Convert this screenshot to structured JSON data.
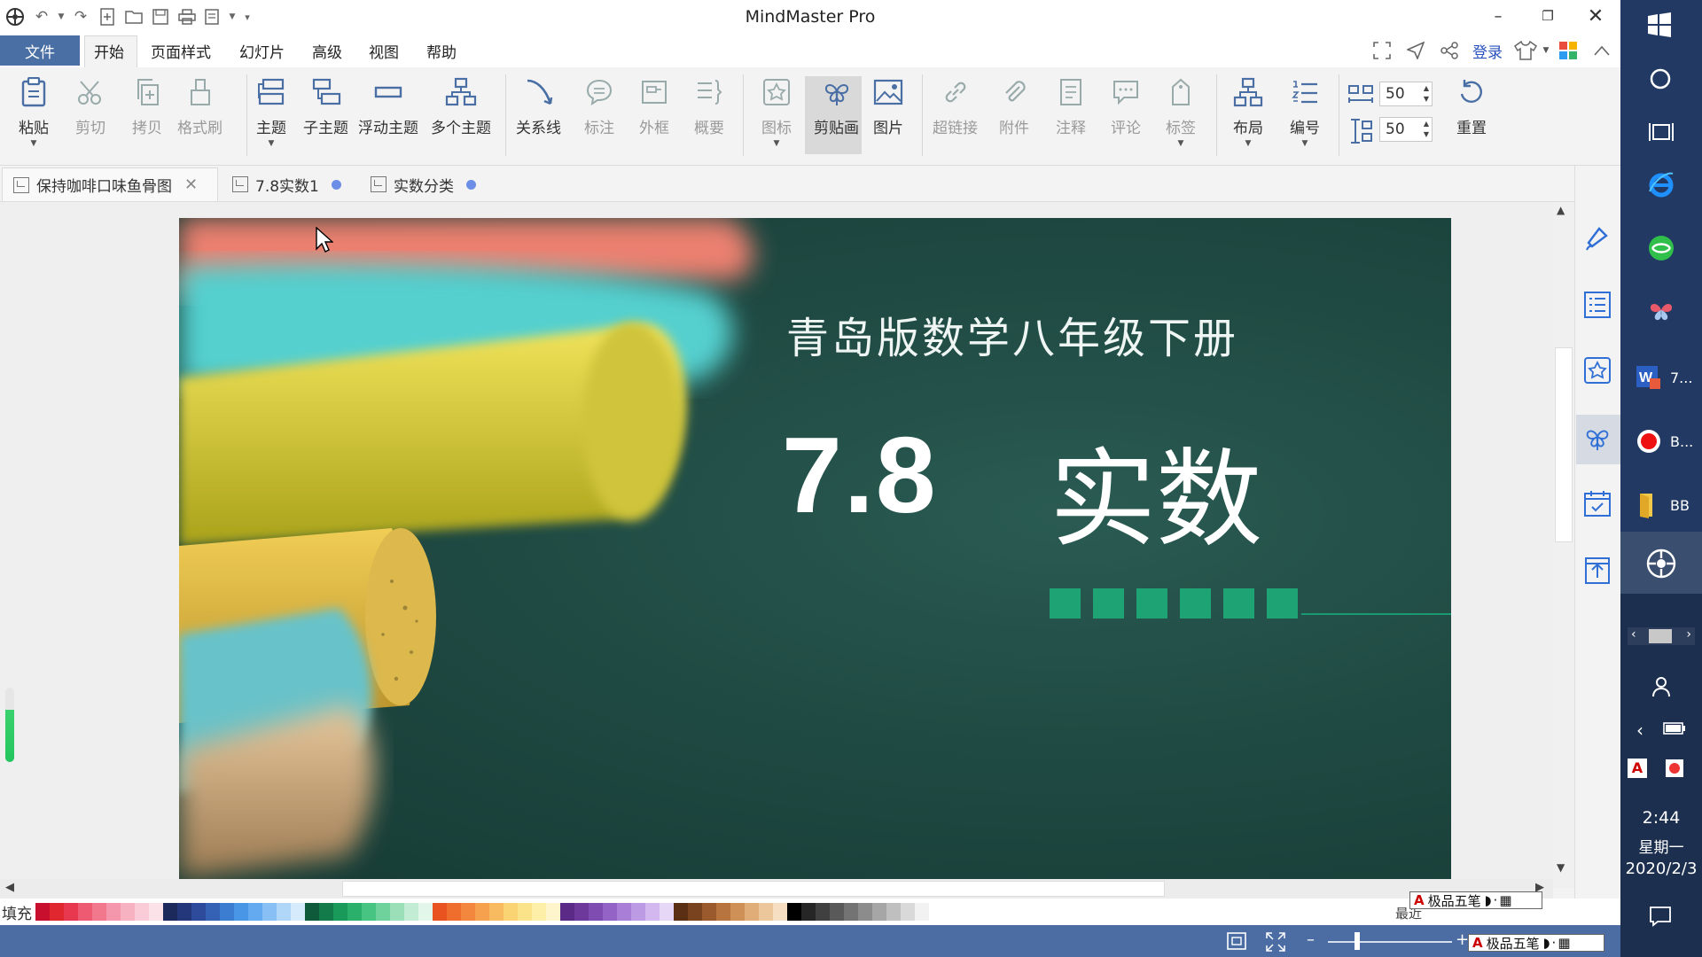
{
  "window": {
    "title": "MindMaster Pro"
  },
  "menu": {
    "file": "文件",
    "items": [
      "开始",
      "页面样式",
      "幻灯片",
      "高级",
      "视图",
      "帮助"
    ],
    "login": "登录"
  },
  "ribbon": {
    "paste": "粘贴",
    "cut": "剪切",
    "copy": "拷贝",
    "format_painter": "格式刷",
    "topic": "主题",
    "subtopic": "子主题",
    "floating_topic": "浮动主题",
    "multiple_topics": "多个主题",
    "relationship": "关系线",
    "callout": "标注",
    "boundary": "外框",
    "summary": "概要",
    "icon": "图标",
    "clipart": "剪贴画",
    "picture": "图片",
    "hyperlink": "超链接",
    "attachment": "附件",
    "note": "注释",
    "comment": "评论",
    "tag": "标签",
    "layout": "布局",
    "numbering": "编号",
    "h_spacing": "50",
    "v_spacing": "50",
    "reset": "重置"
  },
  "tabs": [
    {
      "label": "保持咖啡口味鱼骨图",
      "closable": true
    },
    {
      "label": "7.8实数1",
      "modified": true
    },
    {
      "label": "实数分类",
      "modified": true
    }
  ],
  "slide": {
    "subtitle": "青岛版数学八年级下册",
    "number": "7.8",
    "title": "实数"
  },
  "palette": {
    "label": "填充",
    "recent": "最近",
    "colors": [
      "#c8102e",
      "#e0262f",
      "#e8384f",
      "#ee5a72",
      "#f2788d",
      "#f597ac",
      "#f7b2c2",
      "#f9ccd7",
      "#fbe2e9",
      "#1b2a5a",
      "#24377a",
      "#2d4b9a",
      "#3562b5",
      "#3d7dd1",
      "#4a96e6",
      "#64aaf0",
      "#88c0f5",
      "#b0d7f8",
      "#d6ebfc",
      "#0e5a3a",
      "#137a4a",
      "#1a9a5a",
      "#2bb06b",
      "#47c382",
      "#6fd19c",
      "#9adfb8",
      "#c3ecd4",
      "#e2f6ea",
      "#e8531f",
      "#ef6d2d",
      "#f2873d",
      "#f5a14d",
      "#f8bb5f",
      "#fad372",
      "#fbe38a",
      "#fdeea8",
      "#fef5cc",
      "#5b2a86",
      "#6d3a9c",
      "#7f4db2",
      "#9364c5",
      "#a87ed6",
      "#bd9ae4",
      "#d2b8ef",
      "#e7d7f7",
      "#5a2f14",
      "#7a4320",
      "#9a5a2e",
      "#b8743f",
      "#cf9058",
      "#e0ac78",
      "#ecc79c",
      "#f5dec2",
      "#000000",
      "#262626",
      "#404040",
      "#595959",
      "#737373",
      "#8c8c8c",
      "#a6a6a6",
      "#bfbfbf",
      "#d9d9d9",
      "#f2f2f2"
    ]
  },
  "ime": {
    "text": "极品五笔"
  },
  "taskbar": {
    "items": [
      {
        "label": "7..."
      },
      {
        "label": "B..."
      },
      {
        "label": "BB"
      }
    ],
    "time": "2:44",
    "weekday": "星期一",
    "date": "2020/2/3"
  }
}
